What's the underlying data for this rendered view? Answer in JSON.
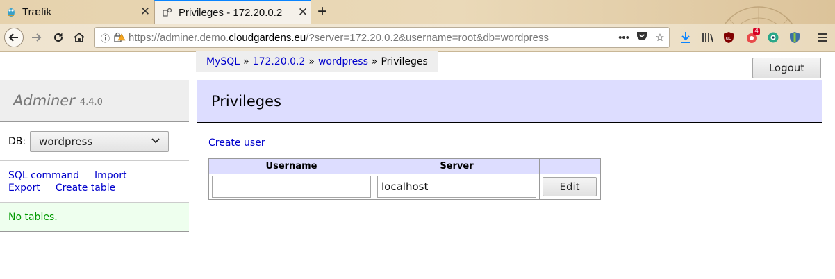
{
  "browser": {
    "tabs": [
      {
        "title": "Træfik",
        "icon": "traefik-gopher-icon",
        "active": false
      },
      {
        "title": "Privileges - 172.20.0.2",
        "icon": "adminer-favicon",
        "active": true
      }
    ],
    "url_prefix": "https://adminer.demo.",
    "url_domain": "cloudgardens.eu",
    "url_rest": "/?server=172.20.0.2&username=root&db=wordpress",
    "extension_badge": "4"
  },
  "breadcrumb": {
    "items": [
      "MySQL",
      "172.20.0.2",
      "wordpress"
    ],
    "separator": "»",
    "current": "Privileges"
  },
  "logout_label": "Logout",
  "sidebar": {
    "app_name": "Adminer",
    "version": "4.4.0",
    "db_label": "DB:",
    "db_selected": "wordpress",
    "links": [
      "SQL command",
      "Import",
      "Export",
      "Create table"
    ],
    "no_tables": "No tables."
  },
  "main": {
    "title": "Privileges",
    "create_user": "Create user",
    "table": {
      "headers": [
        "Username",
        "Server",
        ""
      ],
      "rows": [
        {
          "username": "",
          "server": "localhost",
          "action": "Edit"
        }
      ]
    }
  },
  "colors": {
    "link": "#0000cc",
    "header_bg": "#ddddff",
    "notice_bg": "#eeffee",
    "notice_text": "#009900",
    "active_tab_accent": "#0a84ff"
  }
}
